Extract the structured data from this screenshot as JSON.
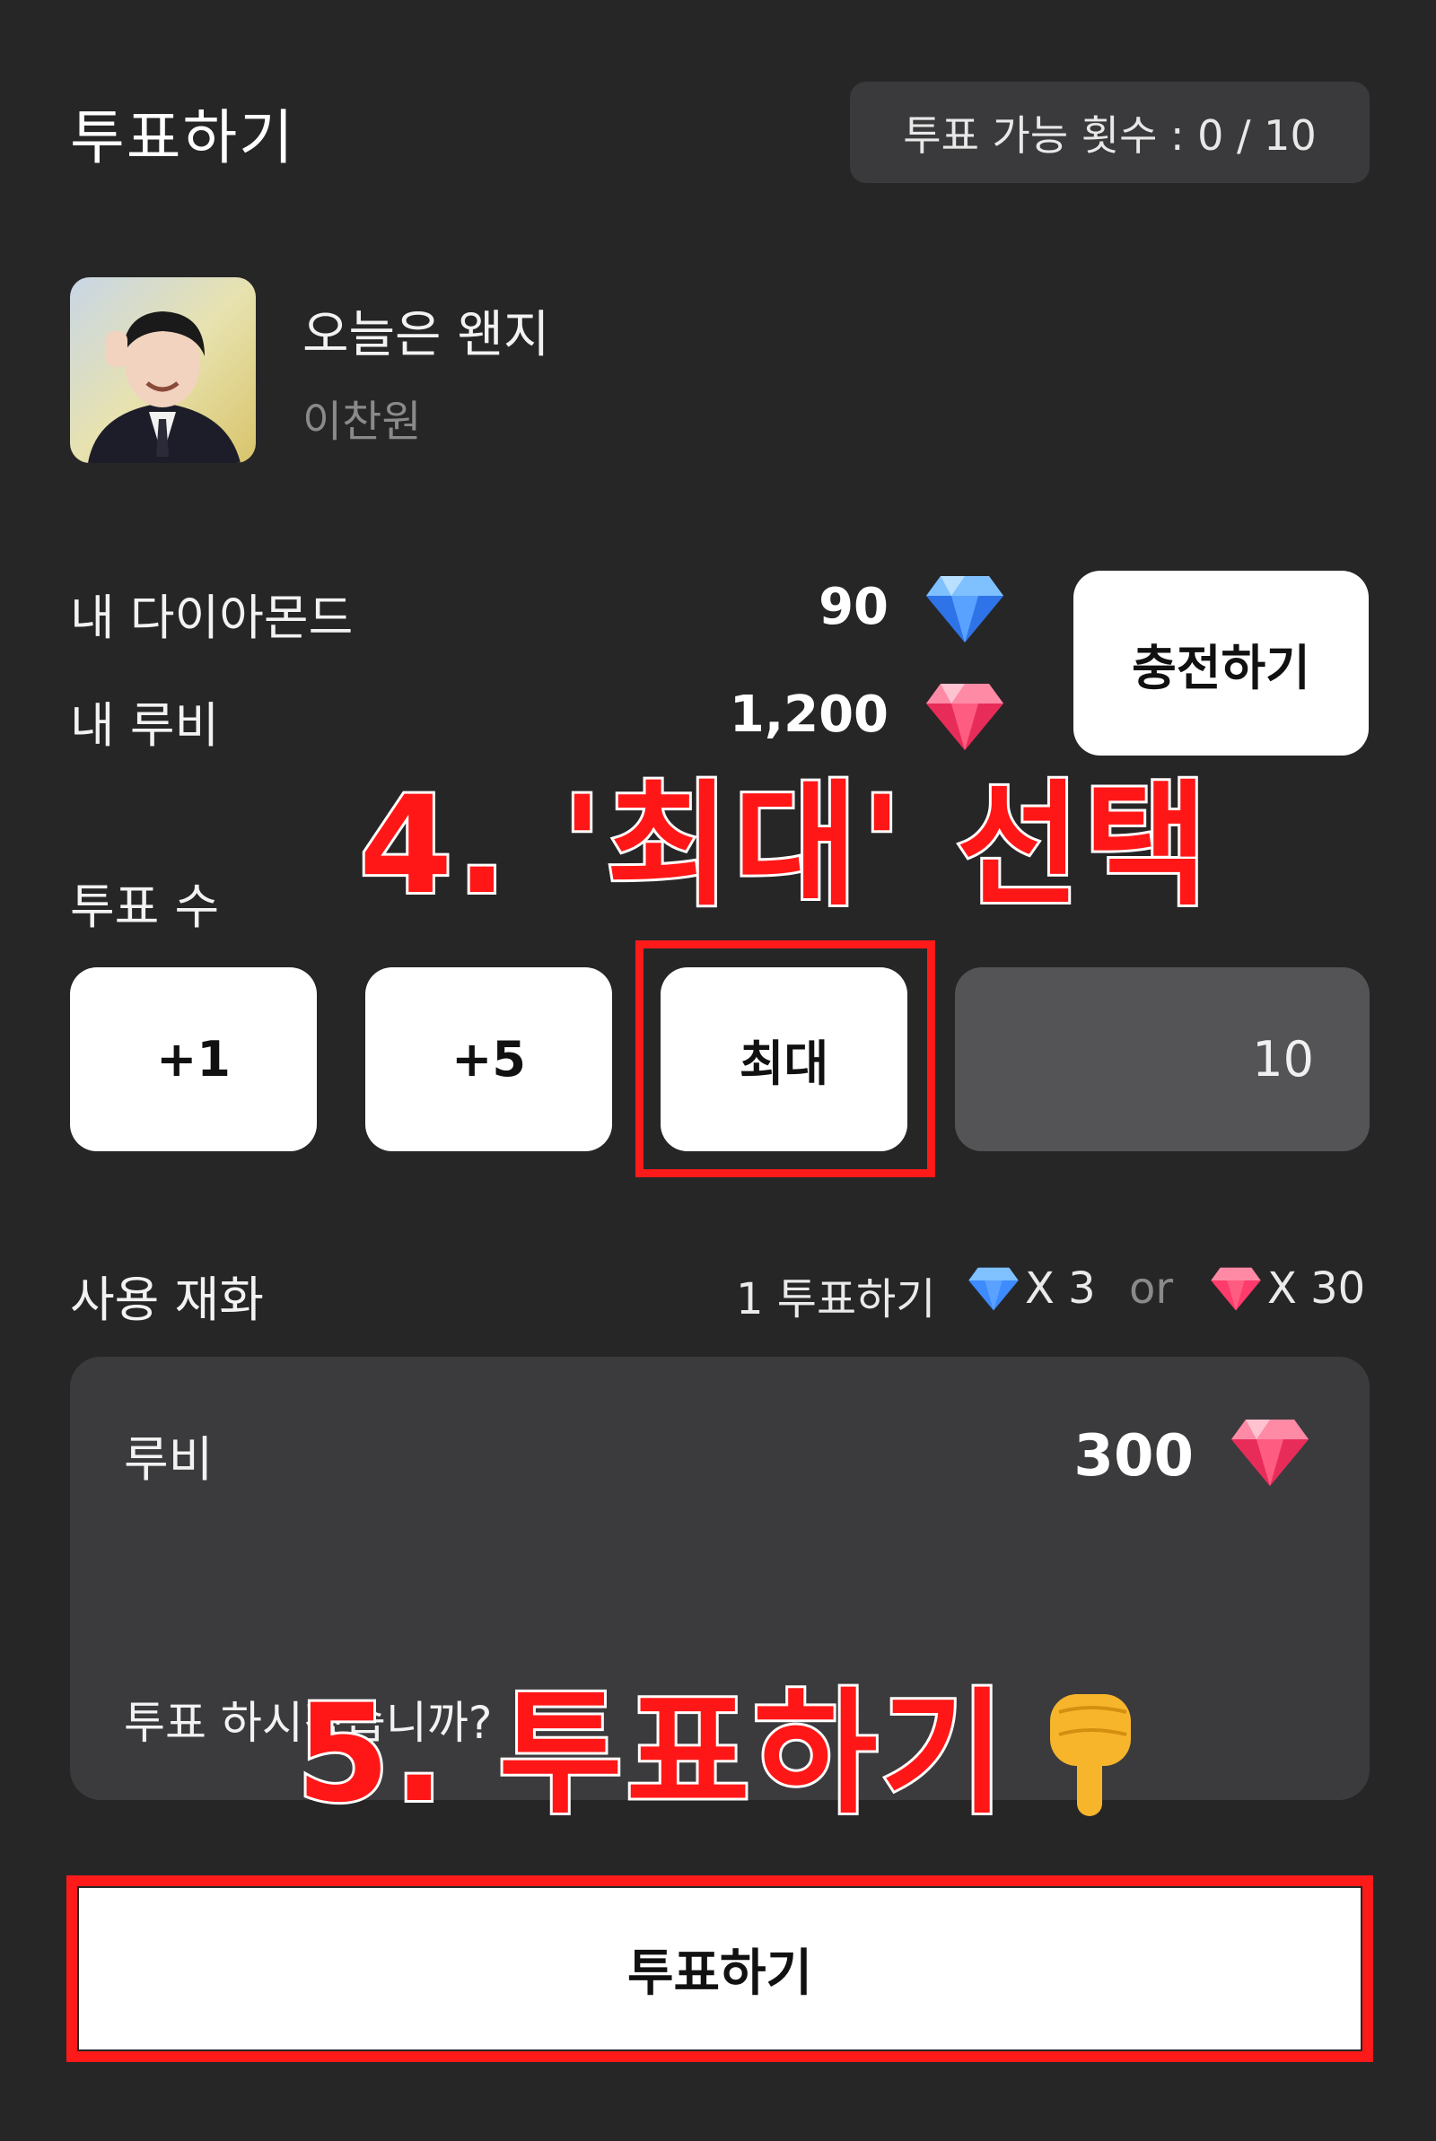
{
  "header": {
    "title": "투표하기",
    "vote_count_label": "투표 가능 횟수 : 0 / 10"
  },
  "song": {
    "title": "오늘은 왠지",
    "artist": "이찬원"
  },
  "balance": {
    "diamond_label": "내 다이아몬드",
    "diamond_value": "90",
    "ruby_label": "내 루비",
    "ruby_value": "1,200",
    "charge_button": "충전하기"
  },
  "vote_count": {
    "label": "투표 수",
    "buttons": [
      "+1",
      "+5",
      "최대"
    ],
    "value": "10"
  },
  "currency": {
    "label": "사용 재화",
    "rate_prefix": "1 투표하기",
    "diamond_rate": "X 3",
    "or": "or",
    "ruby_rate": "X 30",
    "selected_name": "루비",
    "selected_amount": "300",
    "confirm_text": "투표 하시겠습니까?"
  },
  "vote_button": "투표하기",
  "annotations": {
    "step4": "4. '최대' 선택",
    "step5": "5. 투표하기"
  },
  "icons": [
    "diamond-icon",
    "ruby-icon",
    "pointing-down-hand-icon"
  ],
  "colors": {
    "background": "#262627",
    "diamond": "#3d8bff",
    "ruby": "#ff3b6b",
    "annotation": "#ff1717"
  }
}
